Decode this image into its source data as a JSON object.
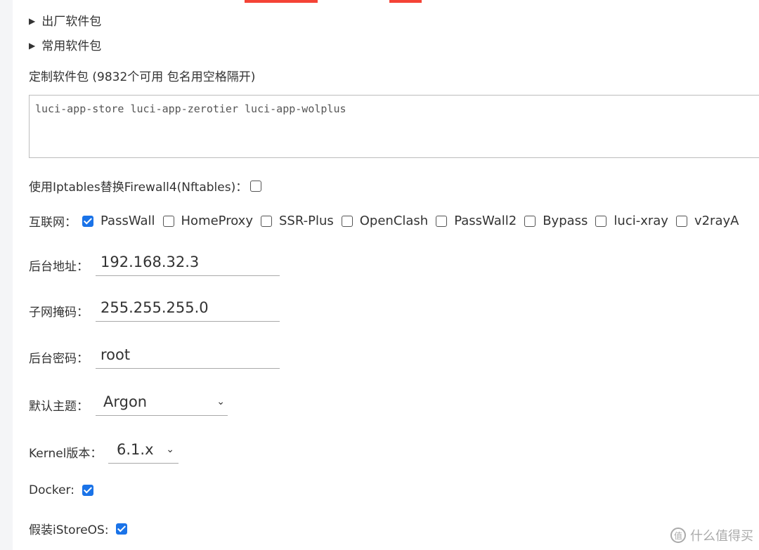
{
  "sections": {
    "factory_packages": "出厂软件包",
    "common_packages": "常用软件包",
    "custom_packages_label": "定制软件包 (9832个可用 包名用空格隔开)",
    "custom_packages_value": "luci-app-store luci-app-zerotier luci-app-wolplus"
  },
  "iptables": {
    "label": "使用Iptables替换Firewall4(Nftables)：",
    "checked": false
  },
  "internet": {
    "label": "互联网：",
    "options": [
      {
        "name": "PassWall",
        "checked": true
      },
      {
        "name": "HomeProxy",
        "checked": false
      },
      {
        "name": "SSR-Plus",
        "checked": false
      },
      {
        "name": "OpenClash",
        "checked": false
      },
      {
        "name": "PassWall2",
        "checked": false
      },
      {
        "name": "Bypass",
        "checked": false
      },
      {
        "name": "luci-xray",
        "checked": false
      },
      {
        "name": "v2rayA",
        "checked": false
      }
    ]
  },
  "backend_address": {
    "label": "后台地址：",
    "value": "192.168.32.3"
  },
  "subnet_mask": {
    "label": "子网掩码：",
    "value": "255.255.255.0"
  },
  "backend_password": {
    "label": "后台密码：",
    "value": "root"
  },
  "default_theme": {
    "label": "默认主题：",
    "value": "Argon"
  },
  "kernel_version": {
    "label": "Kernel版本：",
    "value": "6.1.x"
  },
  "docker": {
    "label": "Docker:",
    "checked": true
  },
  "fake_istoreos": {
    "label": "假装iStoreOS:",
    "checked": true
  },
  "watermark": {
    "text": "什么值得买"
  },
  "colors": {
    "accent": "#1a73e8",
    "top_highlight": "#f44336"
  }
}
